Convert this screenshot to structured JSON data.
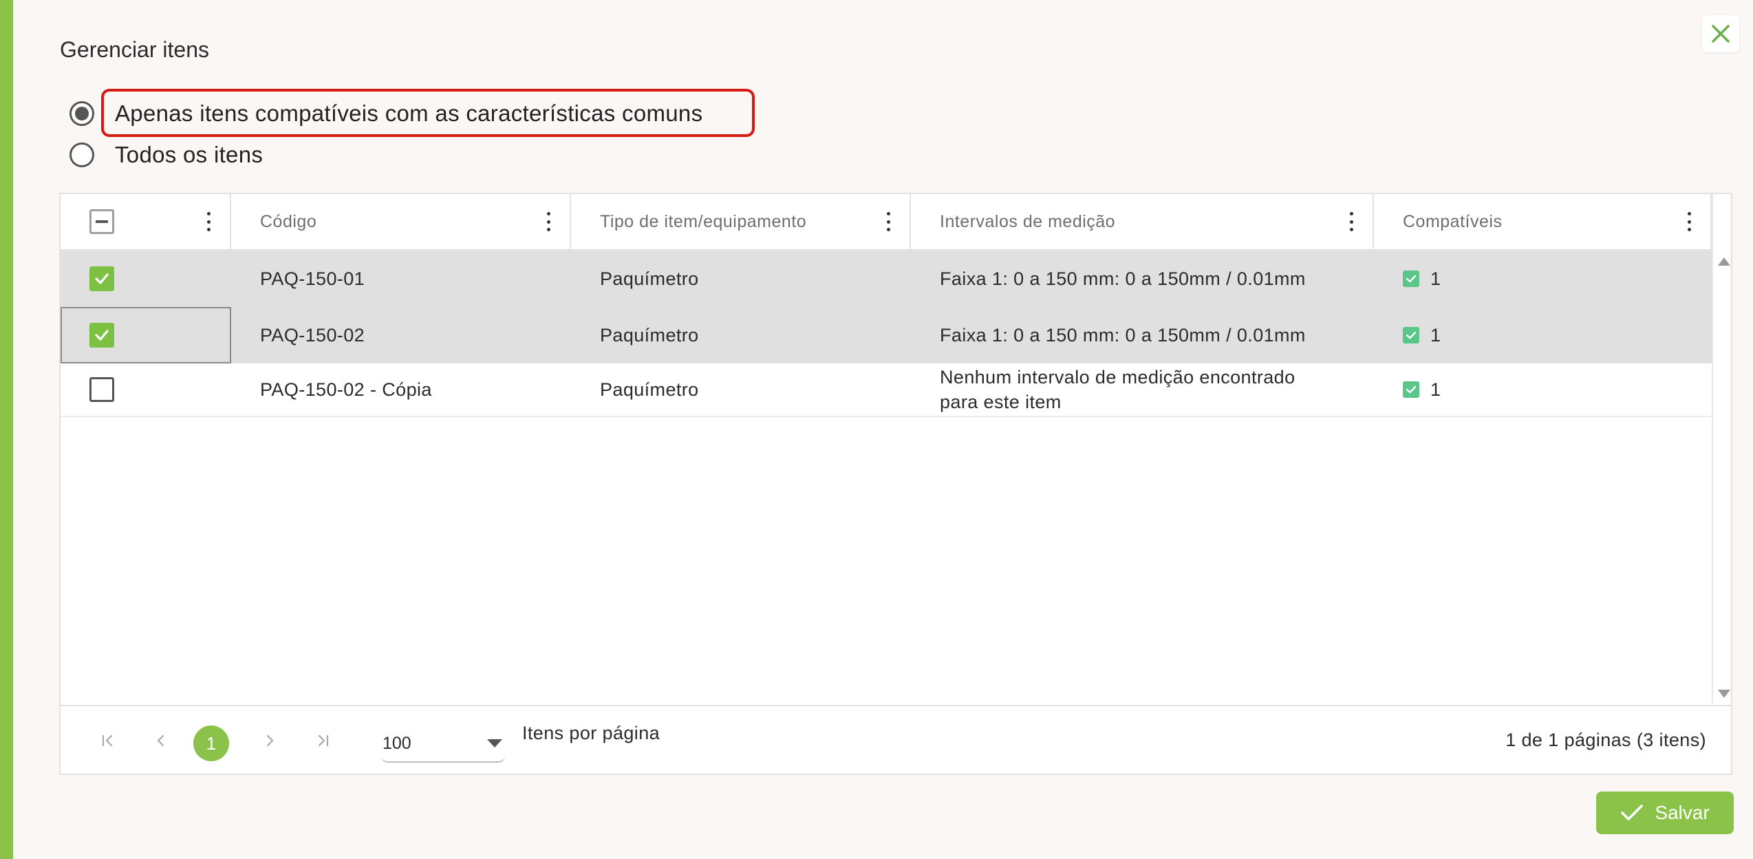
{
  "dialog": {
    "title": "Gerenciar itens"
  },
  "filter": {
    "option_compatible": "Apenas itens compatíveis com as características comuns",
    "option_all": "Todos os itens",
    "selected": "compatible"
  },
  "table": {
    "columns": [
      "Código",
      "Tipo de item/equipamento",
      "Intervalos de medição",
      "Compatíveis"
    ],
    "rows": [
      {
        "codigo": "PAQ-150-01",
        "tipo": "Paquímetro",
        "intervalos": "Faixa 1: 0 a 150 mm: 0 a 150mm / 0.01mm",
        "compativeis": "1",
        "checked": true
      },
      {
        "codigo": "PAQ-150-02",
        "tipo": "Paquímetro",
        "intervalos": "Faixa 1: 0 a 150 mm: 0 a 150mm / 0.01mm",
        "compativeis": "1",
        "checked": true
      },
      {
        "codigo": "PAQ-150-02 - Cópia",
        "tipo": "Paquímetro",
        "intervalos": "Nenhum intervalo de medição encontrado para este item",
        "compativeis": "1",
        "checked": false
      }
    ]
  },
  "pagination": {
    "current_page": "1",
    "page_size": "100",
    "page_size_label": "Itens por página",
    "info": "1 de 1 páginas (3 itens)"
  },
  "actions": {
    "save_label": "Salvar"
  },
  "colors": {
    "accent": "#8bc34a",
    "highlight": "#d81b12",
    "selected_row": "#e0e0e0",
    "compatible_check": "#5bc68a"
  },
  "icons": {
    "close": "close-icon",
    "save": "check-icon",
    "first_page": "first-page-icon",
    "prev_page": "chevron-left-icon",
    "next_page": "chevron-right-icon",
    "last_page": "last-page-icon",
    "column_menu": "kebab-menu-icon"
  }
}
